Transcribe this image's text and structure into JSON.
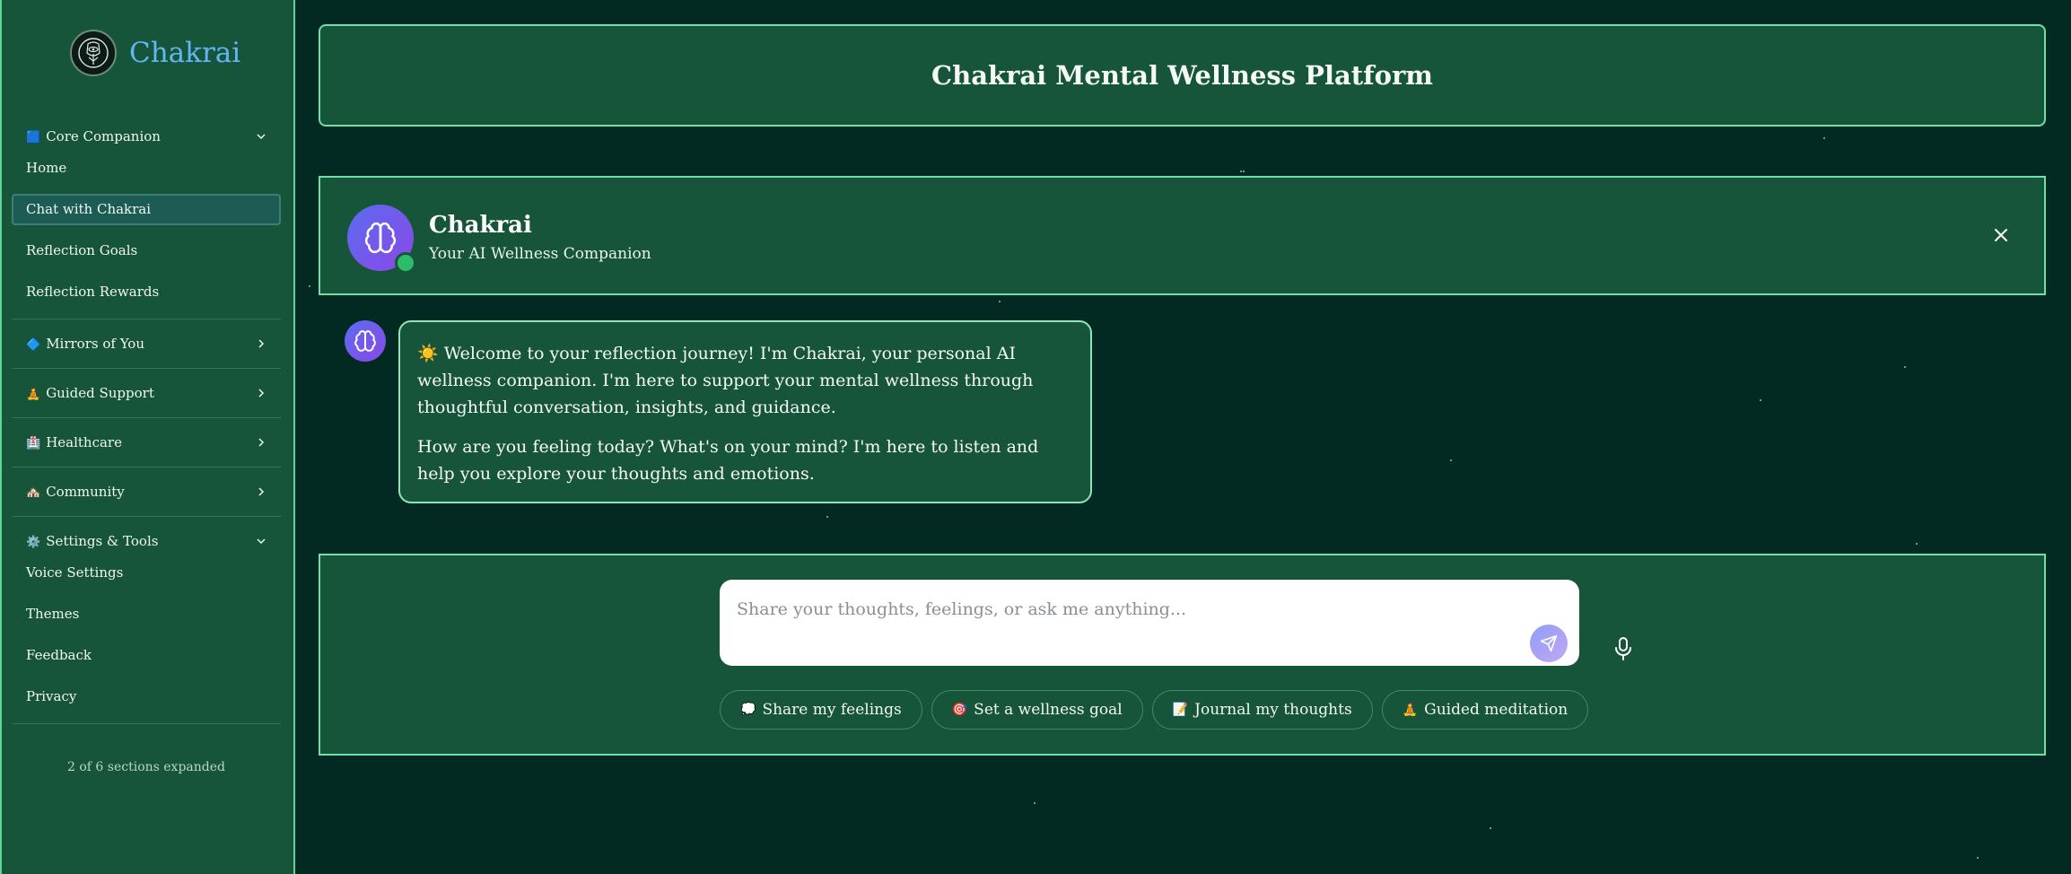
{
  "sidebar": {
    "brand": "Chakrai",
    "sections": [
      {
        "emoji": "🟦",
        "label": "Core Companion",
        "expanded": true,
        "items": [
          "Home",
          "Chat with Chakrai",
          "Reflection Goals",
          "Reflection Rewards"
        ],
        "active": "Chat with Chakrai"
      },
      {
        "emoji": "🔷",
        "label": "Mirrors of You",
        "expanded": false
      },
      {
        "emoji": "🧘",
        "label": "Guided Support",
        "expanded": false
      },
      {
        "emoji": "🏥",
        "label": "Healthcare",
        "expanded": false
      },
      {
        "emoji": "🏘️",
        "label": "Community",
        "expanded": false
      },
      {
        "emoji": "⚙️",
        "label": "Settings & Tools",
        "expanded": true,
        "items": [
          "Voice Settings",
          "Themes",
          "Feedback",
          "Privacy"
        ]
      }
    ],
    "footer": "2 of 6 sections expanded"
  },
  "header": {
    "title": "Chakrai Mental Wellness Platform"
  },
  "companion": {
    "name": "Chakrai",
    "subtitle": "Your AI Wellness Companion"
  },
  "message": {
    "paragraph1": "☀️ Welcome to your reflection journey! I'm Chakrai, your personal AI wellness companion. I'm here to support your mental wellness through thoughtful conversation, insights, and guidance.",
    "paragraph2": "How are you feeling today? What's on your mind? I'm here to listen and help you explore your thoughts and emotions."
  },
  "composer": {
    "placeholder": "Share your thoughts, feelings, or ask me anything..."
  },
  "quick_actions": [
    {
      "emoji": "💭",
      "label": "Share my feelings"
    },
    {
      "emoji": "🎯",
      "label": "Set a wellness goal"
    },
    {
      "emoji": "📝",
      "label": "Journal my thoughts"
    },
    {
      "emoji": "🧘",
      "label": "Guided meditation"
    }
  ],
  "colors": {
    "background": "#032a22",
    "panel": "#17553a",
    "border": "#6fe0aa",
    "brand": "#60b7f2",
    "avatar": "#6b5cf0"
  }
}
